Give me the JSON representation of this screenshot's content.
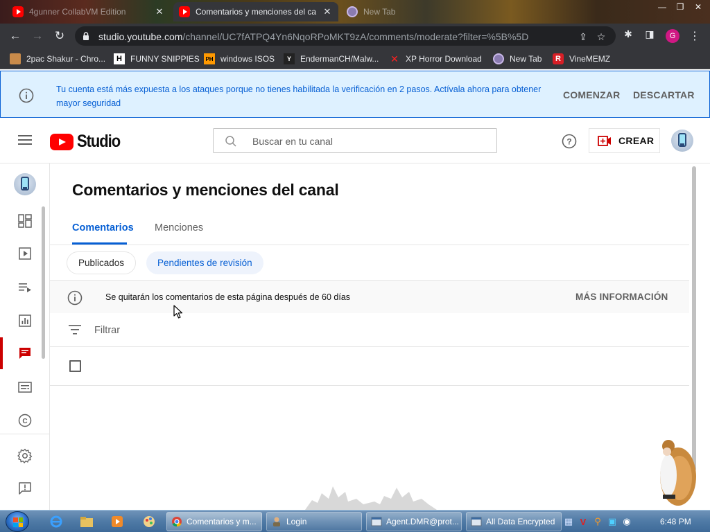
{
  "browser": {
    "tabs": [
      {
        "title": "4gunner CollabVM Edition",
        "state": "inactive"
      },
      {
        "title": "Comentarios y menciones del ca",
        "state": "active"
      },
      {
        "title": "New Tab",
        "state": "inactive"
      }
    ],
    "url_host": "studio.youtube.com",
    "url_path": "/channel/UC7fATPQ4Yn6NqoRPoMKT9zA/comments/moderate?filter=%5B%5D",
    "profile_initial": "G",
    "bookmarks": [
      {
        "label": "2pac Shakur - Chro...",
        "icon": "folder-icon"
      },
      {
        "label": "FUNNY SNIPPIES",
        "icon": "H"
      },
      {
        "label": "windows ISOS",
        "icon": "PH"
      },
      {
        "label": "EndermanCH/Malw...",
        "icon": "Y"
      },
      {
        "label": "XP Horror Download",
        "icon": "X"
      },
      {
        "label": "New Tab",
        "icon": "globe-icon"
      },
      {
        "label": "VineMEMZ",
        "icon": "R"
      }
    ]
  },
  "banner": {
    "message": "Tu cuenta está más expuesta a los ataques porque no tienes habilitada la verificación en 2 pasos. Actívala ahora para obtener mayor seguridad",
    "start_label": "COMENZAR",
    "dismiss_label": "DESCARTAR"
  },
  "header": {
    "logo_text": "Studio",
    "search_placeholder": "Buscar en tu canal",
    "create_label": "CREAR"
  },
  "sidebar": {
    "items": [
      {
        "name": "dashboard",
        "icon": "dashboard-icon",
        "active": false
      },
      {
        "name": "content",
        "icon": "content-icon",
        "active": false
      },
      {
        "name": "playlists",
        "icon": "playlist-icon",
        "active": false
      },
      {
        "name": "analytics",
        "icon": "analytics-icon",
        "active": false
      },
      {
        "name": "comments",
        "icon": "comments-icon",
        "active": true
      },
      {
        "name": "subtitles",
        "icon": "subtitles-icon",
        "active": false
      },
      {
        "name": "copyright",
        "icon": "copyright-icon",
        "active": false
      },
      {
        "name": "settings",
        "icon": "gear-icon",
        "active": false
      },
      {
        "name": "feedback",
        "icon": "feedback-icon",
        "active": false
      }
    ]
  },
  "main": {
    "title": "Comentarios y menciones del canal",
    "tabs": [
      {
        "label": "Comentarios",
        "selected": true
      },
      {
        "label": "Menciones",
        "selected": false
      }
    ],
    "chips": [
      {
        "label": "Publicados",
        "selected": false
      },
      {
        "label": "Pendientes de revisión",
        "selected": true
      }
    ],
    "notice": {
      "text": "Se quitarán los comentarios de esta página después de 60 días",
      "link": "MÁS INFORMACIÓN"
    },
    "filter_placeholder": "Filtrar"
  },
  "taskbar": {
    "buttons": [
      {
        "label": "Comentarios y m...",
        "active": true
      },
      {
        "label": "Login",
        "active": false
      },
      {
        "label": "Agent.DMR@prot...",
        "active": false
      },
      {
        "label": "All Data Encrypted",
        "active": false
      }
    ],
    "clock": "6:48 PM"
  },
  "colors": {
    "accent_blue": "#065fd4",
    "youtube_red": "#ff0000",
    "active_nav_red": "#cc0000",
    "banner_bg": "#def1ff"
  }
}
